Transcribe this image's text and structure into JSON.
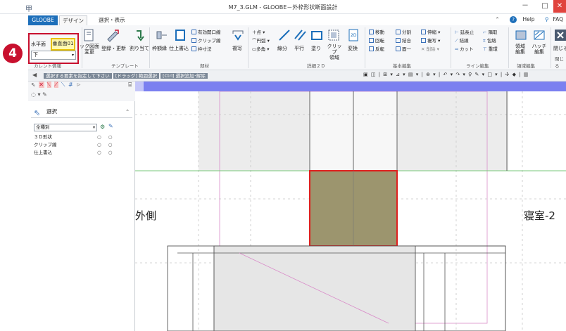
{
  "window": {
    "title": "M7_3.GLM - GLOOBE－外枠形状断面設計",
    "logo_glyph": "甲",
    "minimize": "－",
    "maximize": "□",
    "close": "✕"
  },
  "tabs": {
    "file": "GLOOBE",
    "design": "デザイン",
    "select_view": "選択・表示",
    "help": "Help",
    "faq": "FAQ"
  },
  "ribbon": {
    "current": {
      "plan_label": "水平面",
      "vertical_label": "垂直面01",
      "combo_value": "下",
      "group_label": "カレント情報"
    },
    "template": {
      "apply_label": "ック図面\n変更",
      "register_label": "登録・更新",
      "assign_label": "割り当て",
      "group_label": "テンプレート"
    },
    "parts": {
      "frame_line": "枠額縁",
      "finish_write": "仕上書込",
      "effective_opening": "有効開口線",
      "clip_line": "クリップ線",
      "frame_dim": "枠寸法",
      "copy": "複写",
      "group_label": "部材"
    },
    "detail2d": {
      "point": "点",
      "arc": "円弧",
      "polygon": "多角",
      "line_split": "線分",
      "parallel": "平行",
      "fill": "塗り",
      "clip_area": "クリップ\n領域",
      "convert": "変換",
      "group_label": "詳細２Ｄ"
    },
    "basic_edit": {
      "move": "移動",
      "rotate": "回転",
      "mirror": "反転",
      "split": "分割",
      "join": "結合",
      "one_side": "面一",
      "stretch": "伸縮",
      "copy": "複写",
      "delete": "削除",
      "group_label": "基本編集"
    },
    "line_edit": {
      "extend": "延長止",
      "connect": "結線",
      "cut": "カット",
      "chamfer": "隅取",
      "include": "包絡",
      "overlap": "重環",
      "group_label": "ライン編集"
    },
    "area_edit": {
      "area_edit": "領域\n編集",
      "hatch_edit": "ハッチ\n編集",
      "group_label": "領域編集"
    },
    "close": {
      "label": "閉じる",
      "group_label": "閉じる"
    }
  },
  "callout_number": "4",
  "status_strip": {
    "msg1": "選択する要素を指定して下さい",
    "msg2": "[ドラッグ] 範囲選択",
    "msg3": "[Ctrl] 選択追加･解除"
  },
  "left_panel": {
    "header": "選択",
    "filter_combo": "全種別",
    "rows": [
      {
        "label": "３Ｄ形状",
        "value": "○ ○"
      },
      {
        "label": "クリップ線",
        "value": "○ ○"
      },
      {
        "label": "仕上書込",
        "value": "○ ○"
      }
    ]
  },
  "canvas": {
    "label_outside": "外側",
    "label_bedroom": "寝室-2"
  },
  "colors": {
    "accent": "#1d6fba",
    "highlight_red": "#c8102e",
    "callout_yellow": "#fff9b0",
    "selected_fill": "#9c956e",
    "canvas_bar": "#7b80f0"
  }
}
